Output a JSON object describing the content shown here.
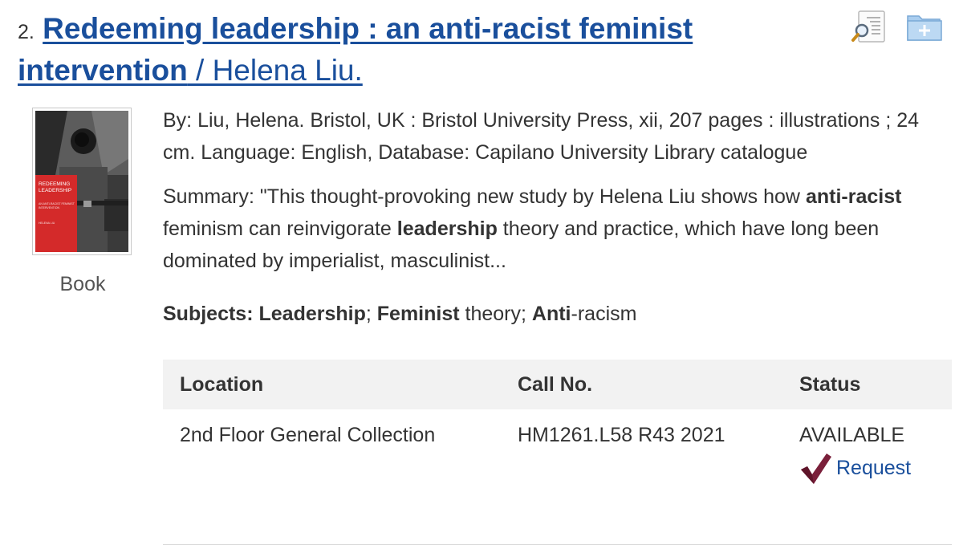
{
  "result": {
    "number": "2.",
    "title_main": "Redeeming leadership : an anti-racist feminist intervention",
    "title_resp": " / Helena Liu.",
    "icons": {
      "preview": "preview-icon",
      "add_folder": "add-to-folder-icon"
    },
    "cover": {
      "alt": "Book cover: Redeeming Leadership",
      "line1": "REDEEMING",
      "line2": "LEADERSHIP",
      "sub": "AN ANTI-RACIST FEMINIST INTERVENTION",
      "author": "HELENA LIU"
    },
    "format": "Book",
    "by_line": "By: Liu, Helena. Bristol, UK : Bristol University Press, xii, 207 pages : illustrations ; 24 cm. Language: English, Database: Capilano University Library catalogue",
    "summary": {
      "prefix": "Summary: \"This thought-provoking new study by Helena Liu shows how ",
      "hl1": "anti-racist",
      "mid1": " feminism can reinvigorate ",
      "hl2": "leadership",
      "suffix": " theory and practice, which have long been dominated by imperialist, masculinist..."
    },
    "subjects": {
      "label": "Subjects: ",
      "s1": "Leadership",
      "sep1": "; ",
      "s2_bold": "Feminist",
      "s2_rest": " theory",
      "sep2": "; ",
      "s3_bold": "Anti",
      "s3_rest": "-racism"
    },
    "holdings": {
      "headers": {
        "location": "Location",
        "call_no": "Call No.",
        "status": "Status"
      },
      "rows": [
        {
          "location": "2nd Floor General Collection",
          "call_no": "HM1261.L58 R43 2021",
          "status": "AVAILABLE",
          "request_label": "Request"
        }
      ]
    }
  },
  "colors": {
    "link": "#1a4f9c",
    "header_bg": "#f2f2f2",
    "request_check": "#7a1f3a"
  }
}
